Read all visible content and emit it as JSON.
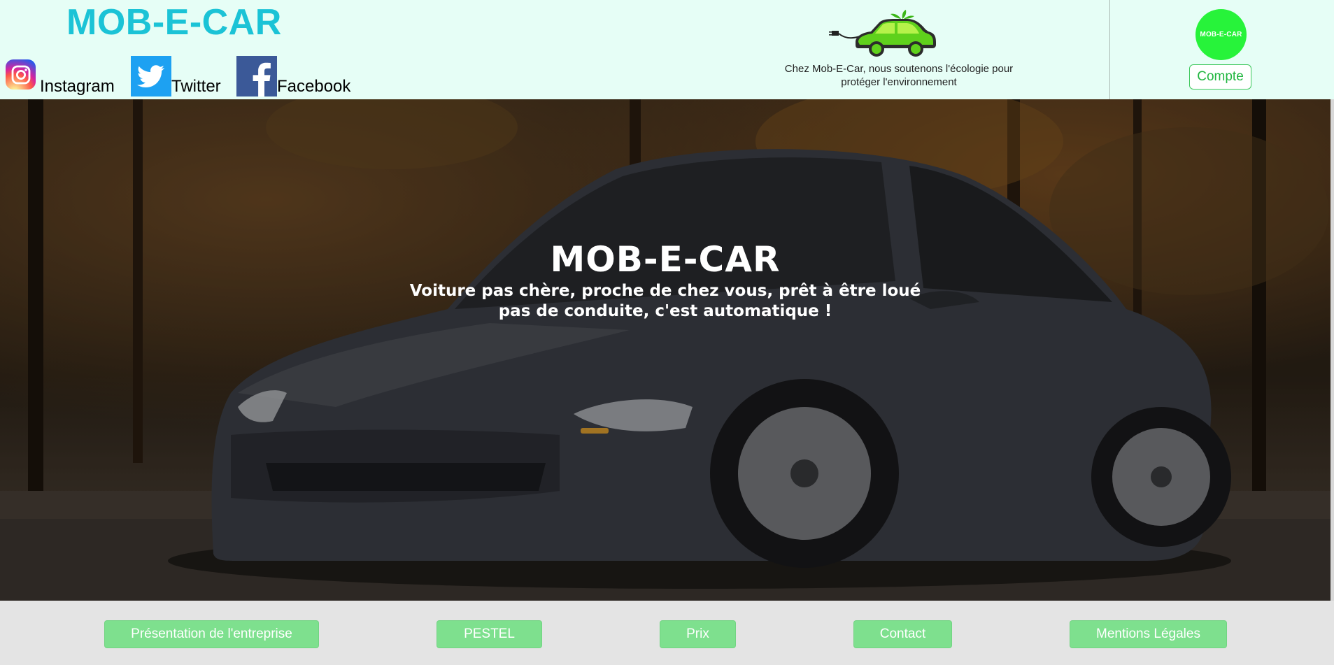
{
  "header": {
    "brand_title": "MOB-E-CAR",
    "social": [
      {
        "label": "Instagram",
        "icon": "instagram-icon"
      },
      {
        "label": "Twitter",
        "icon": "twitter-icon"
      },
      {
        "label": "Facebook",
        "icon": "facebook-icon"
      }
    ],
    "eco_text_line1": "Chez Mob-E-Car, nous soutenons l'écologie pour",
    "eco_text_line2": "protéger l'environnement",
    "avatar_text": "MOB-E-CAR",
    "account_label": "Compte"
  },
  "hero": {
    "title": "MOB-E-CAR",
    "subtitle_line1": "Voiture pas chère, proche de chez vous, prêt à être loué",
    "subtitle_line2": "pas de conduite, c'est automatique !"
  },
  "nav": {
    "presentation": "Présentation de l'entreprise",
    "pestel": "PESTEL",
    "prix": "Prix",
    "contact": "Contact",
    "mentions": "Mentions Légales"
  },
  "colors": {
    "header_bg": "#e6fef6",
    "brand": "#1bc3d6",
    "accent_green": "#27f33a",
    "nav_button": "#7ee08e",
    "footer_bg": "#e4e4e4"
  }
}
